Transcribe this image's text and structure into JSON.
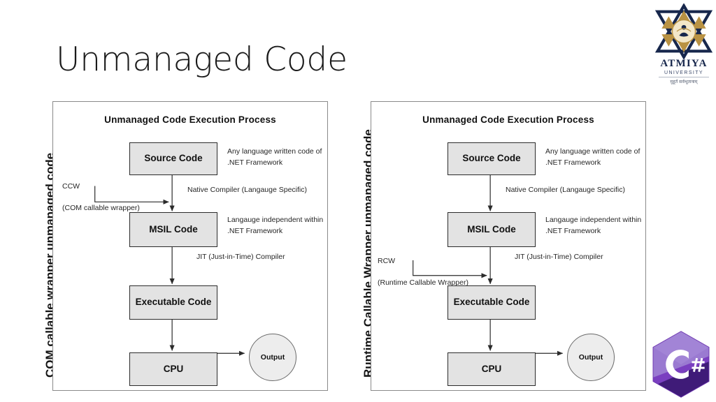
{
  "slide": {
    "title": "Unmanaged Code",
    "background_color": "#ffffff"
  },
  "side_labels": {
    "left": "COM callable wrapper unmanaged code",
    "right": "Runtime Callable Wrapper unmanaged code"
  },
  "diagrams": [
    {
      "id": "left",
      "title": "Unmanaged Code Execution Process",
      "wrapper": {
        "abbr": "CCW",
        "expansion": "(COM callable wrapper)",
        "target": "source-to-msil-arrow"
      },
      "nodes": [
        {
          "id": "source-code",
          "label": "Source Code",
          "shape": "box"
        },
        {
          "id": "msil-code",
          "label": "MSIL Code",
          "shape": "box"
        },
        {
          "id": "executable-code",
          "label": "Executable\nCode",
          "shape": "box"
        },
        {
          "id": "cpu",
          "label": "CPU",
          "shape": "box"
        },
        {
          "id": "output",
          "label": "Output",
          "shape": "circle"
        }
      ],
      "edges": [
        {
          "from": "source-code",
          "to": "msil-code",
          "label": "Native Compiler (Langauge Specific)"
        },
        {
          "from": "msil-code",
          "to": "executable-code",
          "label": "JIT (Just-in-Time) Compiler"
        },
        {
          "from": "executable-code",
          "to": "cpu",
          "label": ""
        },
        {
          "from": "cpu",
          "to": "output",
          "label": ""
        }
      ],
      "annotations": [
        {
          "for": "source-code",
          "text": "Any language written code of\n.NET Framework"
        },
        {
          "for": "msil-code",
          "text": "Langauge independent within\n.NET Framework"
        }
      ]
    },
    {
      "id": "right",
      "title": "Unmanaged Code Execution Process",
      "wrapper": {
        "abbr": "RCW",
        "expansion": "(Runtime Callable Wrapper)",
        "target": "msil-to-executable-arrow"
      },
      "nodes": [
        {
          "id": "source-code",
          "label": "Source Code",
          "shape": "box"
        },
        {
          "id": "msil-code",
          "label": "MSIL Code",
          "shape": "box"
        },
        {
          "id": "executable-code",
          "label": "Executable\nCode",
          "shape": "box"
        },
        {
          "id": "cpu",
          "label": "CPU",
          "shape": "box"
        },
        {
          "id": "output",
          "label": "Output",
          "shape": "circle"
        }
      ],
      "edges": [
        {
          "from": "source-code",
          "to": "msil-code",
          "label": "Native Compiler (Langauge Specific)"
        },
        {
          "from": "msil-code",
          "to": "executable-code",
          "label": "JIT (Just-in-Time) Compiler"
        },
        {
          "from": "executable-code",
          "to": "cpu",
          "label": ""
        },
        {
          "from": "cpu",
          "to": "output",
          "label": ""
        }
      ],
      "annotations": [
        {
          "for": "source-code",
          "text": "Any language written code of\n.NET Framework"
        },
        {
          "for": "msil-code",
          "text": "Langauge independent within\n.NET Framework"
        }
      ]
    }
  ],
  "logos": {
    "university": {
      "name": "ATMIYA",
      "subtitle": "UNIVERSITY",
      "sanskrit": "मुहूर्तं सर्वभूतानाम्",
      "navy": "#17274c",
      "gold": "#b99243"
    },
    "csharp": {
      "glyph_letter": "C",
      "glyph_symbol": "#",
      "purple_light": "#9a7ad1",
      "purple_mid": "#7a3fc0",
      "purple_dark": "#3f1b78"
    }
  },
  "colors": {
    "box_fill": "#e3e3e3",
    "box_stroke": "#2b2b2b",
    "frame_stroke": "#8a8a8a",
    "circle_fill": "#ededed",
    "text": "#111111"
  }
}
